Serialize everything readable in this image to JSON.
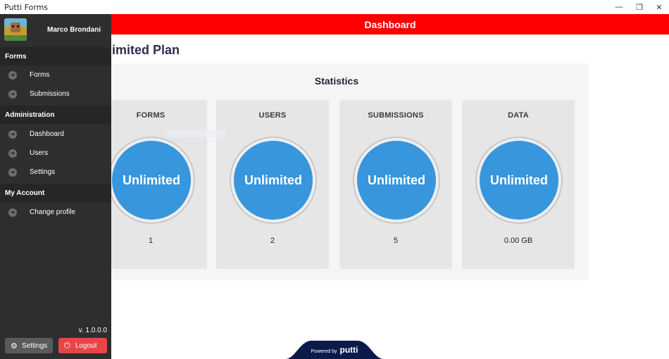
{
  "window": {
    "title": "Putti Forms",
    "controls": {
      "minimize": "—",
      "maximize": "❐",
      "close": "✕"
    }
  },
  "header": {
    "title": "Dashboard"
  },
  "main": {
    "plan_title": "Unlimited Plan",
    "statistics_title": "Statistics",
    "cards": [
      {
        "label": "FORMS",
        "value": "Unlimited",
        "count": "1"
      },
      {
        "label": "USERS",
        "value": "Unlimited",
        "count": "2"
      },
      {
        "label": "SUBMISSIONS",
        "value": "Unlimited",
        "count": "5"
      },
      {
        "label": "DATA",
        "value": "Unlimited",
        "count": "0.00 GB"
      }
    ]
  },
  "footer": {
    "powered_by": "Powered by",
    "brand": "putti"
  },
  "sidebar": {
    "user_name": "Marco Brondani",
    "sections": [
      {
        "title": "Forms",
        "items": [
          "Forms",
          "Submissions"
        ]
      },
      {
        "title": "Administration",
        "items": [
          "Dashboard",
          "Users",
          "Settings"
        ]
      },
      {
        "title": "My Account",
        "items": [
          "Change profile"
        ]
      }
    ],
    "version": "v. 1.0.0.0",
    "settings_button": "Settings",
    "logout_button": "Logout"
  },
  "colors": {
    "header": "#fe0000",
    "sidebar": "#2e2e2e",
    "stat_circle": "#3796dc",
    "logout": "#e84646",
    "footer_badge": "#0c1a4a"
  }
}
